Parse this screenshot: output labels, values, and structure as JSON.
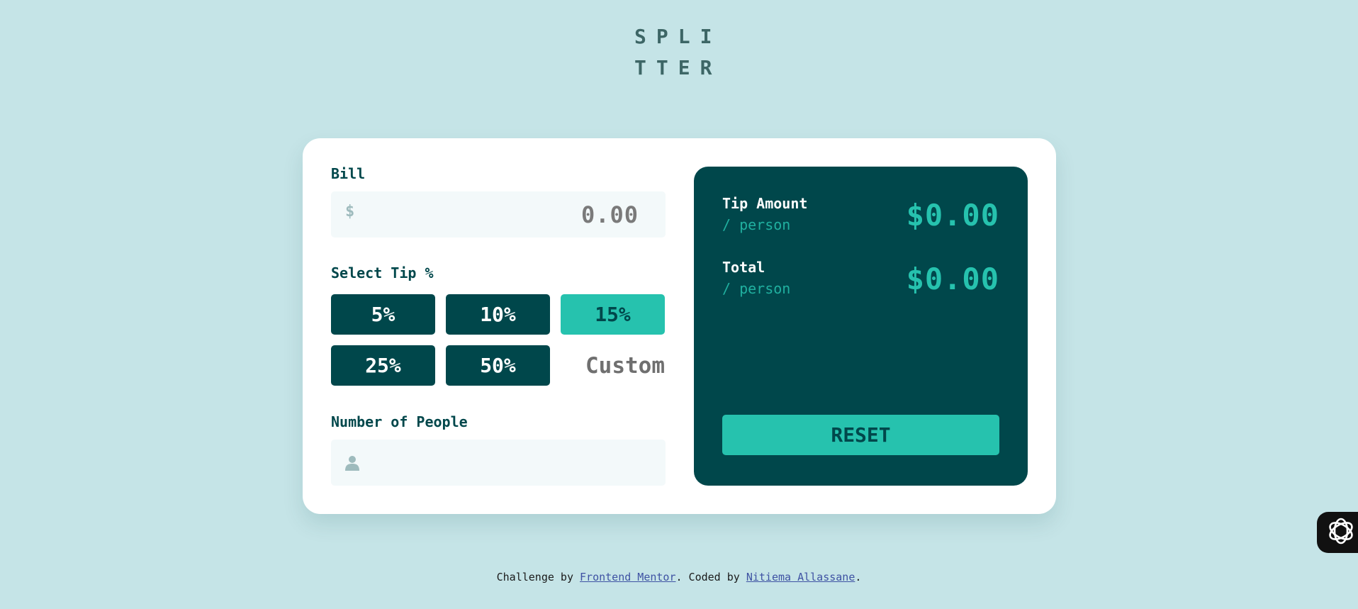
{
  "logo": {
    "line1": "SPLI",
    "line2": "TTER"
  },
  "bill": {
    "label": "Bill",
    "currency_symbol": "$",
    "value": "0.00"
  },
  "tip": {
    "label": "Select Tip %",
    "options": [
      {
        "label": "5%",
        "active": false
      },
      {
        "label": "10%",
        "active": false
      },
      {
        "label": "15%",
        "active": true
      },
      {
        "label": "25%",
        "active": false
      },
      {
        "label": "50%",
        "active": false
      }
    ],
    "custom_placeholder": "Custom"
  },
  "people": {
    "label": "Number of People",
    "value": ""
  },
  "results": {
    "tip_amount": {
      "title": "Tip Amount",
      "sub": "/ person",
      "value": "$0.00"
    },
    "total": {
      "title": "Total",
      "sub": "/ person",
      "value": "$0.00"
    },
    "reset_label": "RESET"
  },
  "footer": {
    "prefix": "Challenge by ",
    "link1": "Frontend Mentor",
    "middle": ". Coded by ",
    "link2": "Nitiema Allassane",
    "suffix": "."
  },
  "colors": {
    "background": "#c5e4e7",
    "dark_cyan": "#00474b",
    "strong_cyan": "#26c2ae",
    "input_bg": "#f3f9fa"
  },
  "icons": {
    "dollar": "dollar-icon",
    "person": "person-icon",
    "widget": "openai-icon"
  }
}
